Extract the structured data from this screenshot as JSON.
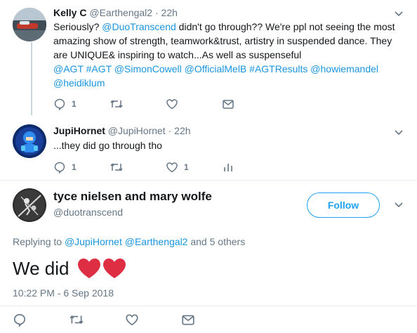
{
  "tweets": [
    {
      "name": "Kelly C",
      "handle": "@Earthengal2",
      "dot": "·",
      "time": "22h",
      "text_parts": [
        {
          "t": "Seriously? ",
          "link": false
        },
        {
          "t": "@DuoTranscend",
          "link": true
        },
        {
          "t": " didn't go through?? We're ppl not seeing the most amazing show of strength, teamwork&trust, artistry in suspended dance. They are UNIQUE& inspiring to watch...As well as suspenseful",
          "link": false
        }
      ],
      "tags": "@AGT #AGT @SimonCowell @OfficialMelB #AGTResults @howiemandel @heidiklum",
      "actions": {
        "reply_count": "1",
        "retweet_count": "",
        "like_count": ""
      },
      "icons": [
        "reply-icon",
        "retweet-icon",
        "heart-icon",
        "envelope-icon"
      ]
    },
    {
      "name": "JupiHornet",
      "handle": "@JupiHornet",
      "dot": "·",
      "time": "22h",
      "text": "...they did go through tho",
      "actions": {
        "reply_count": "1",
        "retweet_count": "",
        "like_count": "1"
      },
      "icons": [
        "reply-icon",
        "retweet-icon",
        "heart-icon",
        "analytics-icon"
      ]
    }
  ],
  "main": {
    "name": "tyce nielsen and mary wolfe",
    "handle": "@duotranscend",
    "follow_label": "Follow",
    "replying_prefix": "Replying to",
    "replying_to_1": "@JupiHornet",
    "replying_to_2": "@Earthengal2",
    "replying_suffix": "and 5 others",
    "text": "We did",
    "emoji": "❤️❤️",
    "timestamp": "10:22 PM - 6 Sep 2018",
    "icons": [
      "reply-icon",
      "retweet-icon",
      "heart-icon",
      "envelope-icon"
    ]
  },
  "colors": {
    "link": "#1b95e0",
    "muted": "#657786",
    "follow": "#1da1f2",
    "heart_emoji": "#dd2e44"
  }
}
